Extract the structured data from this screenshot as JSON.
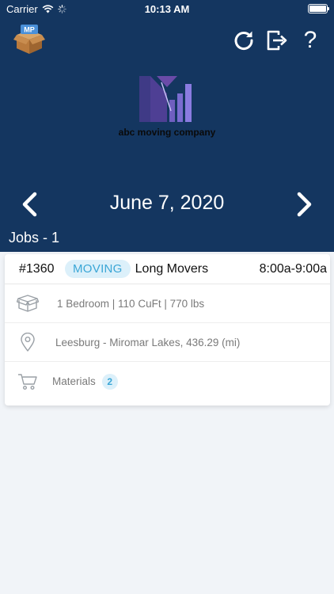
{
  "status_bar": {
    "carrier": "Carrier",
    "time": "10:13 AM",
    "icons": [
      "wifi-icon",
      "activity-spinner-icon",
      "battery-icon"
    ]
  },
  "header": {
    "app_logo_text": "MP",
    "actions": [
      "refresh-icon",
      "logout-icon",
      "help-icon"
    ],
    "help_label": "?",
    "company_name": "abc moving company",
    "bg_color": "#143660"
  },
  "date_nav": {
    "date": "June 7, 2020",
    "prev_icon": "chevron-left-icon",
    "next_icon": "chevron-right-icon"
  },
  "jobs": {
    "label": "Jobs - ",
    "count": "1",
    "items": [
      {
        "id": "#1360",
        "type": "MOVING",
        "customer": "Long Movers",
        "time": "8:00a-9:00a",
        "size": "1 Bedroom | 110 CuFt | 770 lbs",
        "route": "Leesburg - Miromar Lakes, 436.29 (mi)",
        "materials_label": "Materials",
        "materials_count": "2"
      }
    ]
  },
  "colors": {
    "accent": "#3aa6d6",
    "badge_bg": "#dcf0fa",
    "page_bg": "#f1f4f8"
  }
}
